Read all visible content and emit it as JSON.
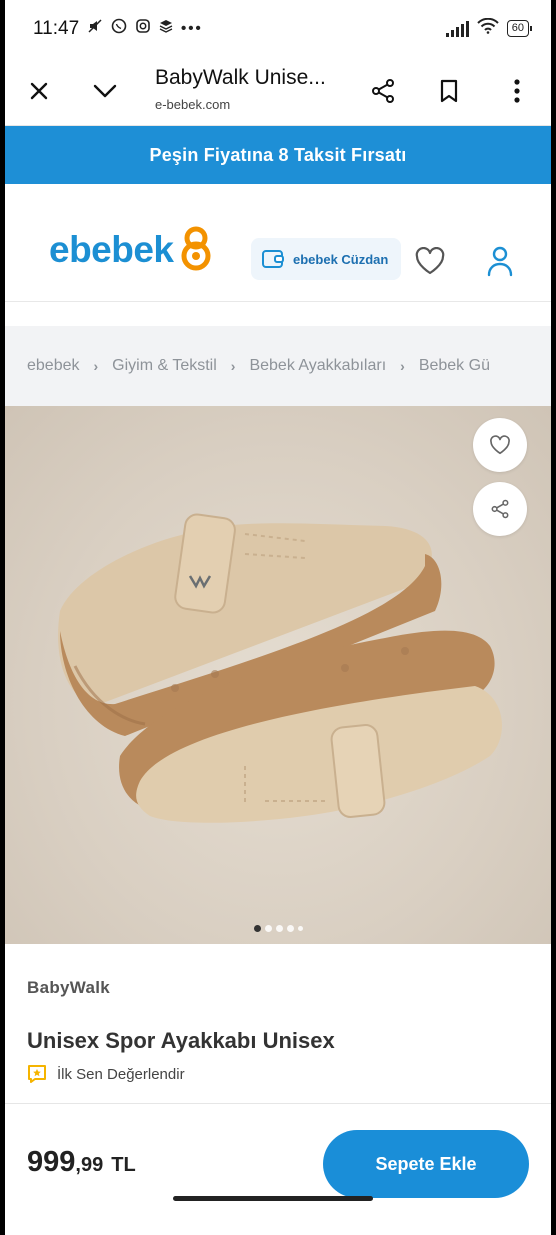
{
  "status_bar": {
    "time": "11:47",
    "battery": "60"
  },
  "browser": {
    "title": "BabyWalk Unise...",
    "url": "e-bebek.com"
  },
  "promo": {
    "text": "Peşin Fiyatına 8 Taksit Fırsatı"
  },
  "header": {
    "logo_text": "ebebek",
    "wallet_label": "ebebek Cüzdan"
  },
  "breadcrumb": {
    "items": [
      "ebebek",
      "Giyim & Tekstil",
      "Bebek Ayakkabıları",
      "Bebek Gü"
    ]
  },
  "gallery": {
    "image_count": 5,
    "active_index": 0
  },
  "product": {
    "brand": "BabyWalk",
    "name": "Unisex Spor Ayakkabı Unisex",
    "rating_text": "İlk Sen Değerlendir"
  },
  "purchase": {
    "price_main": "999",
    "price_cents": ",99",
    "currency": "TL",
    "cart_label": "Sepete Ekle"
  },
  "colors": {
    "brand_blue": "#1e8fd6",
    "logo_orange": "#f39200",
    "rating_yellow": "#f5b400"
  }
}
